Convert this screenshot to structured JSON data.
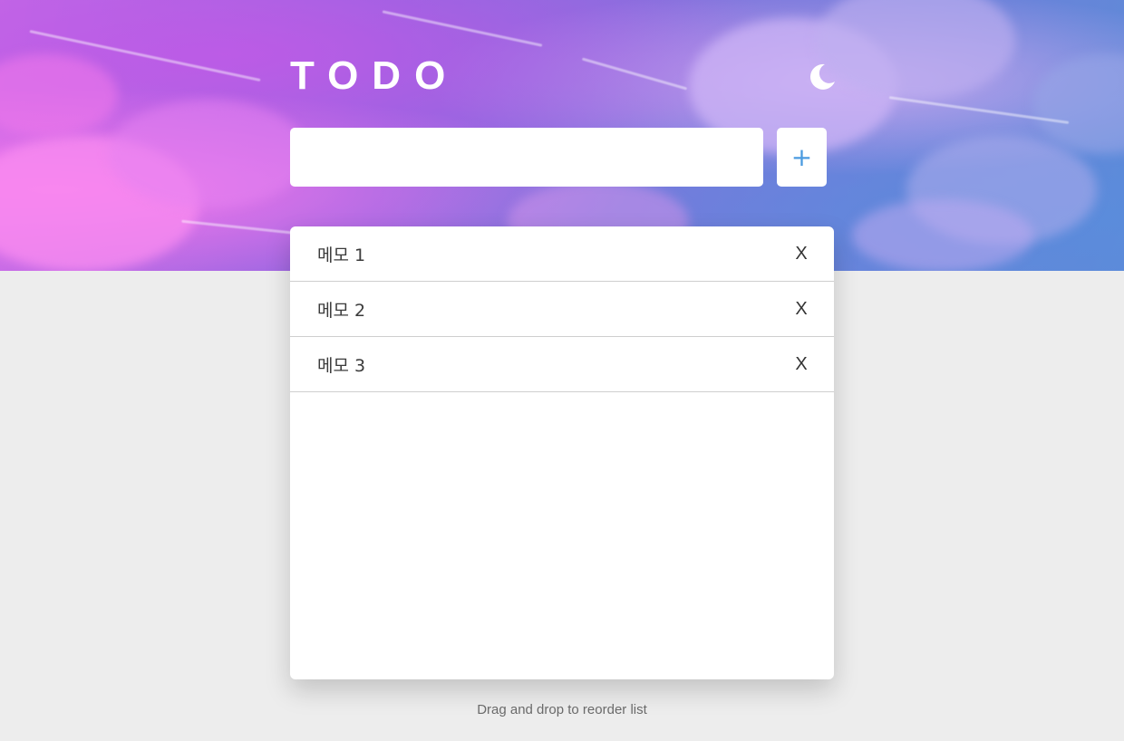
{
  "header": {
    "title": "TODO",
    "theme_icon": "moon-icon"
  },
  "new_todo": {
    "value": "",
    "placeholder": "",
    "add_icon": "plus-icon",
    "add_label": "+"
  },
  "todos": [
    {
      "text": "메모 1",
      "delete_label": "X"
    },
    {
      "text": "메모 2",
      "delete_label": "X"
    },
    {
      "text": "메모 3",
      "delete_label": "X"
    }
  ],
  "footer": {
    "hint": "Drag and drop to reorder list"
  },
  "colors": {
    "accent": "#4b9be0",
    "page_background": "#ededed",
    "card_background": "#ffffff"
  }
}
